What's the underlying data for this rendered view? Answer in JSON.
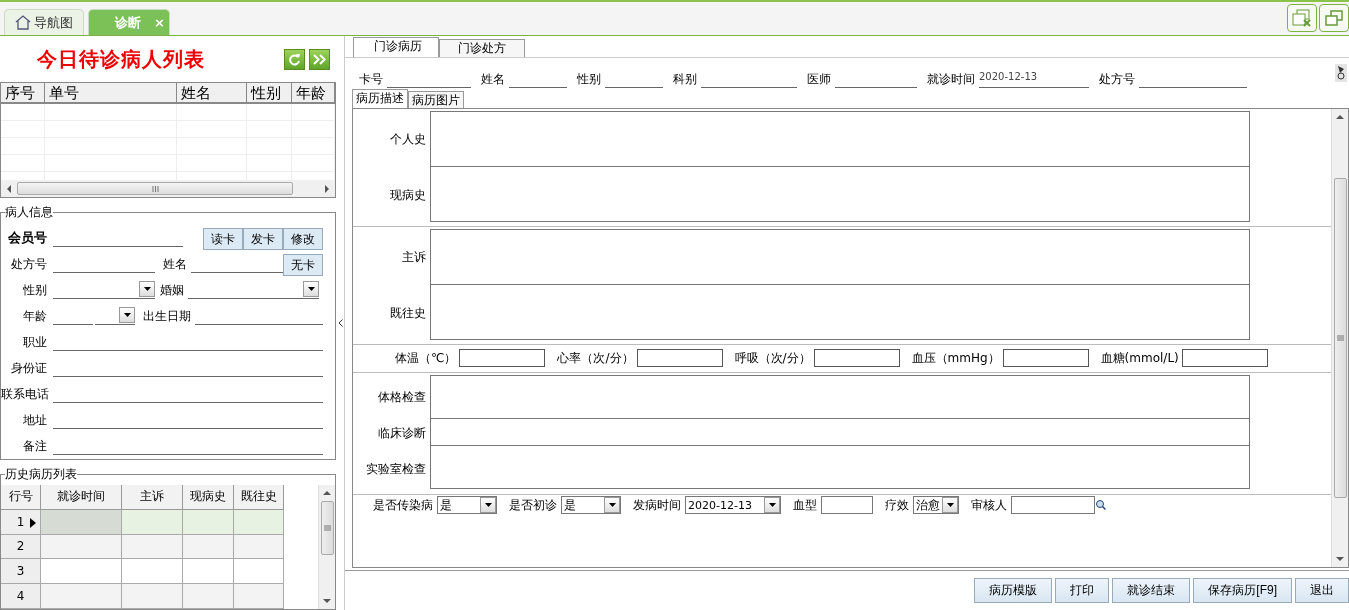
{
  "doc_tabs": [
    {
      "label": "导航图",
      "selected": false,
      "kind": "home"
    },
    {
      "label": "诊断",
      "selected": true,
      "kind": "closable",
      "close": "×"
    }
  ],
  "queue": {
    "title": "今日待诊病人列表",
    "columns": [
      "序号",
      "单号",
      "姓名",
      "性别",
      "年龄"
    ]
  },
  "patient_info": {
    "title": "病人信息",
    "card_buttons": [
      "读卡",
      "发卡",
      "修改"
    ],
    "no_card_button": "无卡",
    "rows": [
      [
        {
          "kind": "key",
          "label": "会员号"
        }
      ],
      [
        {
          "kind": "text",
          "label": "处方号"
        },
        {
          "kind": "text",
          "label": "姓名"
        }
      ],
      [
        {
          "kind": "select",
          "label": "性别"
        },
        {
          "kind": "select",
          "label": "婚姻"
        }
      ],
      [
        {
          "kind": "age",
          "label": "年龄"
        },
        {
          "kind": "text",
          "label": "出生日期"
        }
      ],
      [
        {
          "kind": "wide",
          "label": "职业"
        }
      ],
      [
        {
          "kind": "wide",
          "label": "身份证"
        }
      ],
      [
        {
          "kind": "wide",
          "label": "联系电话"
        }
      ],
      [
        {
          "kind": "wide",
          "label": "地址"
        }
      ],
      [
        {
          "kind": "wide",
          "label": "备注"
        }
      ]
    ]
  },
  "history": {
    "title": "历史病历列表",
    "columns": [
      "行号",
      "就诊时间",
      "主诉",
      "现病史",
      "既往史"
    ],
    "rows": [
      {
        "number": "1",
        "current": true
      },
      {
        "number": "2",
        "current": false
      },
      {
        "number": "3",
        "current": false
      },
      {
        "number": "4",
        "current": false
      }
    ]
  },
  "record_tabs": [
    {
      "label": "门诊病历",
      "selected": true
    },
    {
      "label": "门诊处方",
      "selected": false
    }
  ],
  "header_fields": [
    {
      "label": "卡号"
    },
    {
      "label": "姓名"
    },
    {
      "label": "性别"
    },
    {
      "label": "科别"
    },
    {
      "label": "医师"
    },
    {
      "label": "就诊时间",
      "value": "2020-12-13"
    },
    {
      "label": "处方号"
    }
  ],
  "sub_tabs": [
    {
      "label": "病历描述",
      "selected": true
    },
    {
      "label": "病历图片",
      "selected": false
    }
  ],
  "sections": [
    {
      "kind": "textareas",
      "items": [
        "个人史",
        "现病史"
      ]
    },
    {
      "kind": "textareas",
      "items": [
        "主诉",
        "既往史"
      ]
    },
    {
      "kind": "vitals",
      "items": [
        "体温（℃）",
        "心率（次/分）",
        "呼吸（次/分）",
        "血压（mmHg）",
        "血糖(mmol/L)"
      ]
    },
    {
      "kind": "textareas",
      "items": [
        "体格检查",
        "临床诊断",
        "实验室检查"
      ]
    },
    {
      "kind": "options",
      "items": [
        {
          "kind": "select",
          "label": "是否传染病",
          "value": "是"
        },
        {
          "kind": "select",
          "label": "是否初诊",
          "value": "是"
        },
        {
          "kind": "date",
          "label": "发病时间",
          "value": "2020-12-13"
        },
        {
          "kind": "text",
          "label": "血型"
        },
        {
          "kind": "select",
          "label": "疗效",
          "value": "治愈"
        },
        {
          "kind": "search",
          "label": "审核人"
        }
      ]
    }
  ],
  "buttons": [
    "病历模版",
    "打印",
    "就诊结束",
    "保存病历[F9]",
    "退出"
  ]
}
